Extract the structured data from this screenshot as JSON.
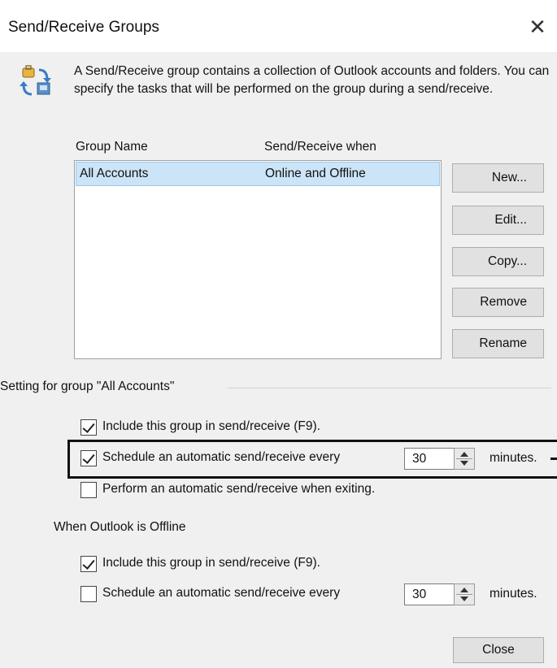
{
  "window": {
    "title": "Send/Receive Groups",
    "close_glyph": "✕"
  },
  "description": "A Send/Receive group contains a collection of Outlook accounts and folders. You can specify the tasks that will be performed on the group during a send/receive.",
  "groups_table": {
    "columns": [
      "Group Name",
      "Send/Receive when"
    ],
    "rows": [
      {
        "name": "All Accounts",
        "when": "Online and Offline",
        "selected": true
      }
    ]
  },
  "buttons": {
    "new": "New...",
    "edit": "Edit...",
    "copy": "Copy...",
    "remove": "Remove",
    "rename": "Rename",
    "close": "Close"
  },
  "settings": {
    "section_label": "Setting for group \"All Accounts\"",
    "online": {
      "include": {
        "label": "Include this group in send/receive (F9).",
        "checked": true
      },
      "schedule": {
        "label": "Schedule an automatic send/receive every",
        "checked": true,
        "value": "30",
        "unit": "minutes."
      },
      "on_exit": {
        "label": "Perform an automatic send/receive when exiting.",
        "checked": false
      }
    },
    "offline_label": "When Outlook is Offline",
    "offline": {
      "include": {
        "label": "Include this group in send/receive (F9).",
        "checked": true
      },
      "schedule": {
        "label": "Schedule an automatic send/receive every",
        "checked": false,
        "value": "30",
        "unit": "minutes."
      }
    }
  },
  "icons": {
    "group_icon": "send-receive-groups-icon",
    "selection_color": "#cce4f7"
  }
}
